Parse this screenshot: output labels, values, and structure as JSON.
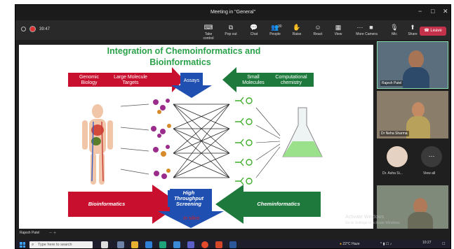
{
  "window": {
    "title": "Meeting in \"General\"",
    "controls": [
      "−",
      "□",
      "✕"
    ]
  },
  "toolbar": {
    "timer": "39:47",
    "buttons": [
      {
        "label": "Take control",
        "icon": "take-control-icon",
        "glyph": "⌨"
      },
      {
        "label": "Pop out",
        "icon": "pop-out-icon",
        "glyph": "⧉"
      },
      {
        "label": "Chat",
        "icon": "chat-icon",
        "glyph": "💬"
      },
      {
        "label": "People",
        "icon": "people-icon",
        "glyph": "👥",
        "count": "30"
      },
      {
        "label": "Raise",
        "icon": "raise-hand-icon",
        "glyph": "✋"
      },
      {
        "label": "React",
        "icon": "react-icon",
        "glyph": "☺"
      },
      {
        "label": "View",
        "icon": "view-icon",
        "glyph": "▦"
      },
      {
        "label": "More",
        "icon": "more-icon",
        "glyph": "⋯"
      },
      {
        "label": "Camera",
        "icon": "camera-icon",
        "glyph": "■"
      },
      {
        "label": "Mic",
        "icon": "mic-off-icon",
        "glyph": "🎙"
      },
      {
        "label": "Share",
        "icon": "share-icon",
        "glyph": "⬆"
      }
    ],
    "leave_label": "Leave"
  },
  "slide": {
    "title_line1": "Integration of Chemoinformatics and",
    "title_line2": "Bioinformatics",
    "genomic": "Genomic Biology",
    "large_molecule": "Large Molecule Targets",
    "assays": "Assays",
    "small_molecules": "Small Molecules",
    "computational": "Computational chemistry",
    "bioinformatics": "Bioinformatics",
    "hts": "High Throughput Screening",
    "in_silico": "In silico",
    "cheminformatics": "Cheminformatics"
  },
  "presenter_tag": "Rajesh Patel",
  "participants": [
    {
      "name": "Rajesh Patel"
    },
    {
      "name": "Dr Neha Sharma"
    },
    {
      "name": "Dr. Asha Si..."
    }
  ],
  "view_all": "View all",
  "watermark": {
    "line1": "Activate Windows",
    "line2": "Go to Settings to activate Windows."
  },
  "taskbar": {
    "search_placeholder": "Type here to search",
    "weather": "22°C  Haze",
    "time": "10:27",
    "date": "..."
  },
  "colors": {
    "leave": "#c4314b",
    "title_green": "#2aa24a",
    "bio_red": "#c8102e",
    "chem_green": "#1e7a3c",
    "assay_blue": "#1f4fb0"
  }
}
